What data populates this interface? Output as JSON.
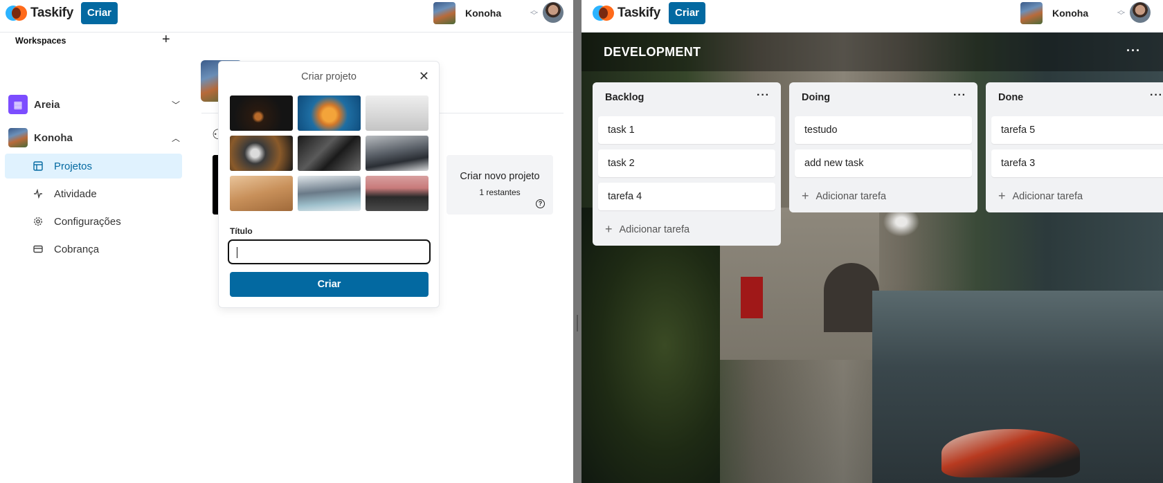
{
  "app": {
    "logo_name": "Taskify",
    "create_label": "Criar",
    "org_name": "Konoha"
  },
  "sidebar": {
    "workspaces_label": "Workspaces",
    "workspaces": [
      {
        "name": "Areia",
        "icon": "building-icon",
        "expanded": false
      },
      {
        "name": "Konoha",
        "icon": "konoha-thumb",
        "expanded": true
      }
    ],
    "nav": [
      {
        "label": "Projetos",
        "icon": "layout-icon",
        "active": true
      },
      {
        "label": "Atividade",
        "icon": "activity-icon",
        "active": false
      },
      {
        "label": "Configurações",
        "icon": "settings-icon",
        "active": false
      },
      {
        "label": "Cobrança",
        "icon": "credit-card-icon",
        "active": false
      }
    ]
  },
  "main": {
    "new_project_card": {
      "title": "Criar novo projeto",
      "remaining": "1 restantes"
    }
  },
  "popover": {
    "title": "Criar projeto",
    "field_label": "Título",
    "input_value": "",
    "submit_label": "Criar",
    "image_count": 9
  },
  "board": {
    "title": "DEVELOPMENT",
    "add_task_label": "Adicionar tarefa",
    "lists": [
      {
        "title": "Backlog",
        "cards": [
          "task 1",
          "task 2",
          "tarefa 4"
        ]
      },
      {
        "title": "Doing",
        "cards": [
          "testudo",
          "add new task"
        ]
      },
      {
        "title": "Done",
        "cards": [
          "tarefa 5",
          "tarefa 3"
        ]
      }
    ]
  },
  "colors": {
    "primary": "#0369a1",
    "active_nav_bg": "#e0f2fe",
    "list_bg": "#f1f2f4"
  }
}
